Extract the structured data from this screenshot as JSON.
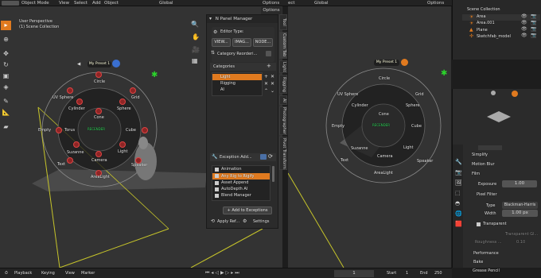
{
  "header": {
    "mode": "Object Mode",
    "menus": [
      "View",
      "Select",
      "Add",
      "Object"
    ],
    "transform": "Global",
    "transform2": "Global",
    "fragment": "ect",
    "options": "Options",
    "options2": "Options"
  },
  "viewport": {
    "line1": "User Perspective",
    "line2": "(1) Scene Collection"
  },
  "pie_menu": {
    "preset": "My Preset 1",
    "center": "RECENDER",
    "items": [
      "Circle",
      "Grid",
      "Sphere",
      "Cube",
      "Light",
      "Speaker",
      "AreaLight",
      "Camera",
      "Suzanne",
      "Text",
      "Empty",
      "Torus",
      "Cylinder",
      "UV Sphere",
      "Cone"
    ]
  },
  "npanel": {
    "title": "N Panel Manager",
    "options": "Options",
    "editor_type": "Editor Type:",
    "view_btn": "VIEW...",
    "image_btn": "IMAG...",
    "node_btn": "NODE...",
    "category_reorder": "Category Reorderi...",
    "categories_header": "Categories",
    "categories": [
      {
        "name": "Light",
        "selected": true
      },
      {
        "name": "Rigging",
        "selected": false
      },
      {
        "name": "AI",
        "selected": false
      }
    ],
    "exception_header": "Exception Add...",
    "exceptions": [
      "Animation",
      "Any Rig to Rigify",
      "Asset Append",
      "AutoDepth AI",
      "Blend Manager"
    ],
    "add_to_exceptions": "Add to Exceptions",
    "apply_ref": "Apply Ref...",
    "settings": "Settings"
  },
  "side_tabs": [
    "Tool",
    "Custom Tab",
    "Light",
    "Rigging",
    "AI",
    "Photographer",
    "Pivot Transform"
  ],
  "outliner": {
    "items": [
      "Scene Collection",
      "Area",
      "Area.001",
      "Plane",
      "Sketchfab_model"
    ]
  },
  "properties": {
    "sections": [
      "Simplify",
      "Motion Blur",
      "Film"
    ],
    "exposure_label": "Exposure",
    "exposure_value": "1.00",
    "pixel_filter": "Pixel Filter",
    "type_label": "Type",
    "type_value": "Blackman-Harris",
    "width_label": "Width",
    "width_value": "1.00 px",
    "transparent": "Transparent",
    "transparent_glass": "Transparent Gl...",
    "roughness_label": "Roughness ...",
    "roughness_value": "0.10",
    "more_sections": [
      "Performance",
      "Bake",
      "Grease Pencil"
    ]
  },
  "timeline": {
    "playback": "Playback",
    "keying": "Keying",
    "view": "View",
    "marker": "Marker",
    "current_frame": "1",
    "start_label": "Start",
    "start_value": "1",
    "end_label": "End",
    "end_value": "250"
  },
  "colors": {
    "accent": "#e07a1f",
    "selected_blue": "#4a6fa5",
    "pie_red": "#d44444"
  }
}
